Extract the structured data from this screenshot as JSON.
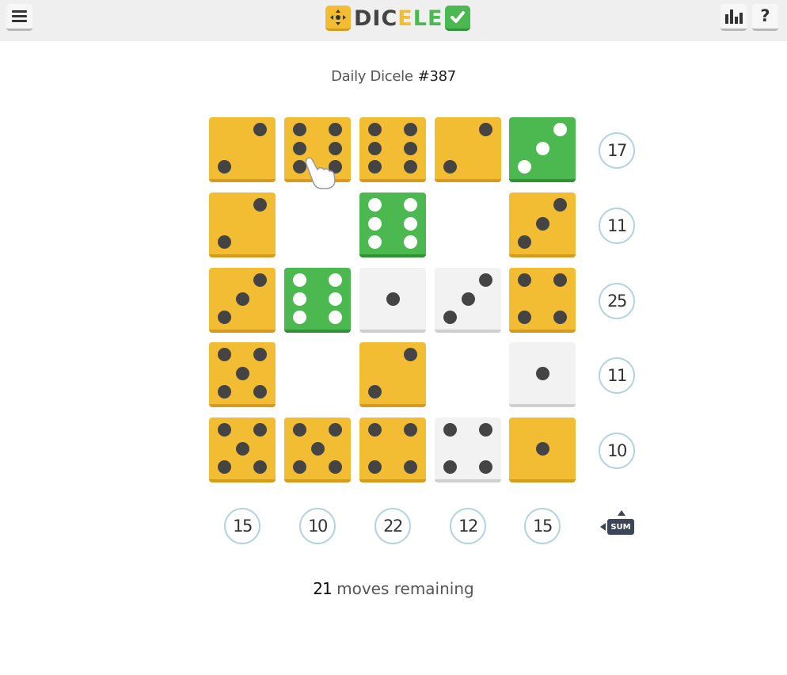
{
  "header": {
    "menu_icon": "hamburger-menu-icon",
    "logo_text": [
      "D",
      "I",
      "C",
      "E",
      "L",
      "E"
    ],
    "logo_colors": [
      "#444444",
      "#444444",
      "#444444",
      "#f2bd33",
      "#4cb850",
      "#4cb850"
    ],
    "stats_icon": "bar-chart-icon",
    "help_label": "?"
  },
  "subtitle": {
    "label": "Daily Dicele",
    "number": "#387"
  },
  "colors": {
    "yellow": "#f2bd33",
    "green": "#4cb850",
    "white": "#f2f2f2",
    "pip_dark": "#444444",
    "pip_light": "#ffffff"
  },
  "grid": [
    [
      {
        "value": 2,
        "color": "yellow"
      },
      {
        "value": 6,
        "color": "yellow"
      },
      {
        "value": 6,
        "color": "yellow"
      },
      {
        "value": 2,
        "color": "yellow"
      },
      {
        "value": 3,
        "color": "green"
      }
    ],
    [
      {
        "value": 2,
        "color": "yellow"
      },
      null,
      {
        "value": 6,
        "color": "green"
      },
      null,
      {
        "value": 3,
        "color": "yellow"
      }
    ],
    [
      {
        "value": 3,
        "color": "yellow"
      },
      {
        "value": 6,
        "color": "green"
      },
      {
        "value": 1,
        "color": "white"
      },
      {
        "value": 3,
        "color": "white"
      },
      {
        "value": 4,
        "color": "yellow"
      }
    ],
    [
      {
        "value": 5,
        "color": "yellow"
      },
      null,
      {
        "value": 2,
        "color": "yellow"
      },
      null,
      {
        "value": 1,
        "color": "white"
      }
    ],
    [
      {
        "value": 5,
        "color": "yellow"
      },
      {
        "value": 5,
        "color": "yellow"
      },
      {
        "value": 4,
        "color": "yellow"
      },
      {
        "value": 4,
        "color": "white"
      },
      {
        "value": 1,
        "color": "yellow"
      }
    ]
  ],
  "row_sums": [
    "17",
    "11",
    "25",
    "11",
    "10"
  ],
  "col_sums": [
    "15",
    "10",
    "22",
    "12",
    "15"
  ],
  "sum_toggle_label": "SUM",
  "moves": {
    "count": "21",
    "label": "moves remaining"
  }
}
